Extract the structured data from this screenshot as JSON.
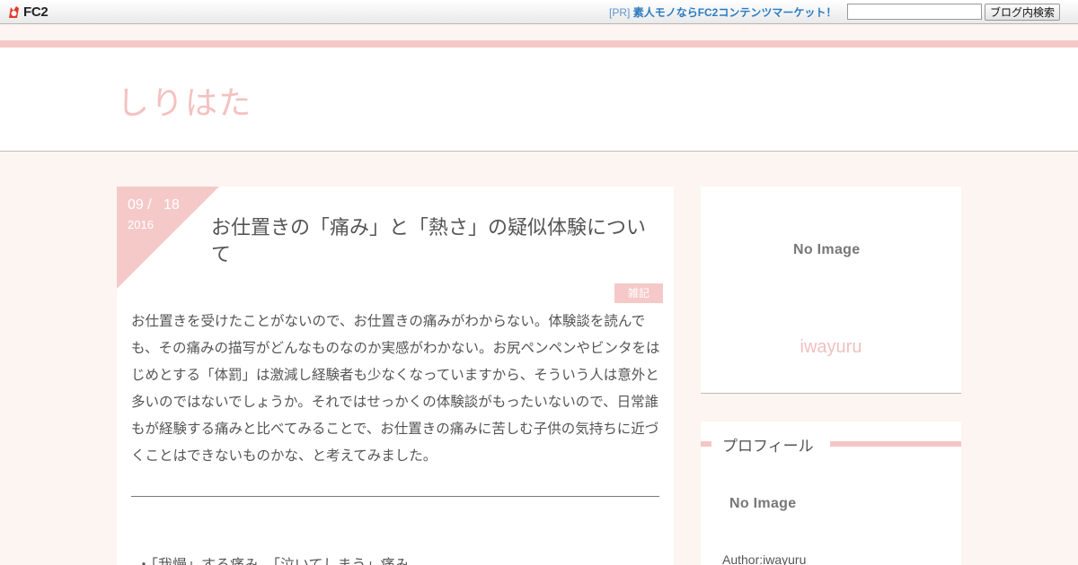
{
  "topbar": {
    "logo_text": "FC2",
    "pr_prefix": "[PR]",
    "pr_text": "素人モノならFC2コンテンツマーケット！",
    "search_placeholder": "",
    "search_button": "ブログ内検索"
  },
  "blog": {
    "title": "しりはた"
  },
  "article": {
    "date_md": "09 /   18",
    "date_year": "2016",
    "title": "お仕置きの「痛み」と「熱さ」の疑似体験について",
    "category": "雑記",
    "body": "お仕置きを受けたことがないので、お仕置きの痛みがわからない。体験談を読んでも、その痛みの描写がどんなものなのか実感がわかない。お尻ペンペンやビンタをはじめとする「体罰」は激減し経験者も少なくなっていますから、そういう人は意外と多いのではないでしょうか。それではせっかくの体験談がもったいないので、日常誰もが経験する痛みと比べてみることで、お仕置きの痛みに苦しむ子供の気持ちに近づくことはできないものかな、と考えてみました。",
    "bullet_item": "・「我慢」する痛み、「泣いてしまう」痛み"
  },
  "sidebar": {
    "card": {
      "no_image": "No Image",
      "author": "iwayuru"
    },
    "profile": {
      "title": "プロフィール",
      "no_image": "No Image",
      "author_line": "Author:iwayuru"
    }
  },
  "colors": {
    "accent_pink": "#f6c9c9",
    "title_pink": "#f4c1c1",
    "link_blue": "#2a7bc0"
  }
}
